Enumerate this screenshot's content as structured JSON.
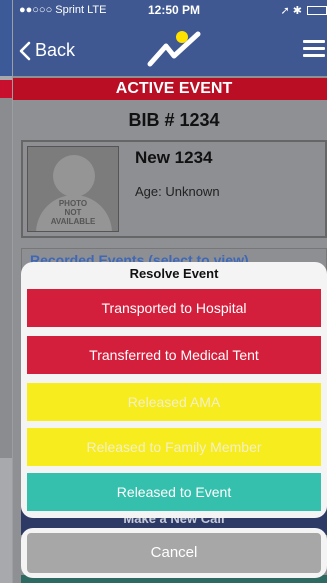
{
  "status_bar": {
    "carrier": "●●○○○ Sprint  LTE",
    "time": "12:50 PM",
    "indicators": "➚ ✱"
  },
  "nav": {
    "back_label": "Back",
    "back_icon": "chevron-left-icon",
    "menu_icon": "hamburger-menu-icon"
  },
  "banner": {
    "label": "ACTIVE EVENT"
  },
  "bib": {
    "label": "BIB # 1234"
  },
  "patient": {
    "name": "New 1234",
    "age": "Age: Unknown",
    "photo_text": "PHOTO\nNOT\nAVAILABLE"
  },
  "recorded_events": {
    "label": "Recorded Events (select to view)"
  },
  "make_call": {
    "label": "Make a New Call"
  },
  "action_sheet": {
    "title": "Resolve Event",
    "options": [
      {
        "label": "Transported to Hospital",
        "bg": "#d31f3c",
        "fg": "#ffffff"
      },
      {
        "label": "Transferred to Medical Tent",
        "bg": "#d31f3c",
        "fg": "#ffffff"
      },
      {
        "label": "Released AMA",
        "bg": "#f7ec1d",
        "fg": "#f3f0c8"
      },
      {
        "label": "Released to Family Member",
        "bg": "#f7ec1d",
        "fg": "#f3f0c8"
      },
      {
        "label": "Released to Event",
        "bg": "#35bfad",
        "fg": "#ffffff"
      }
    ],
    "cancel_label": "Cancel"
  },
  "colors": {
    "nav_blue": "#3f5892",
    "alert_red": "#b90e24",
    "logo_yellow": "#ffe100"
  }
}
